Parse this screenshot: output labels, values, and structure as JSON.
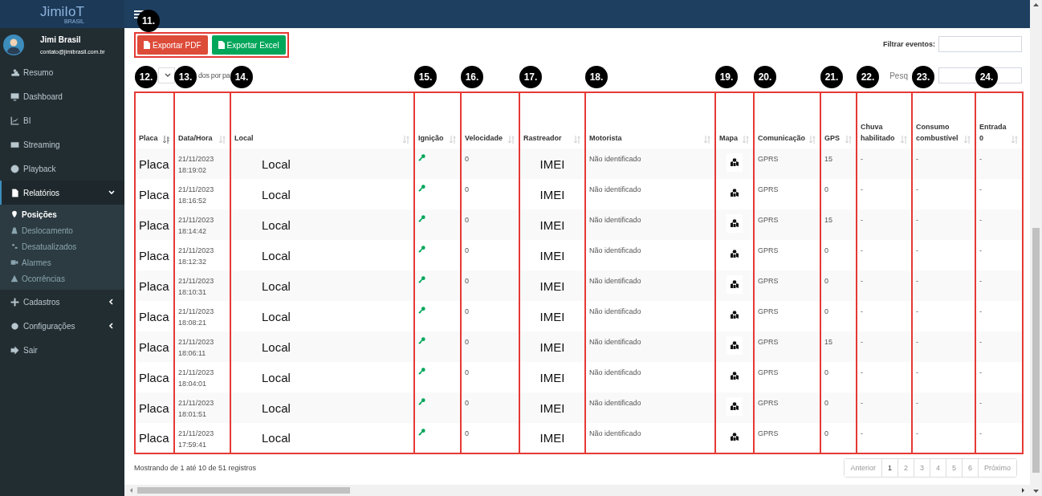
{
  "logo": {
    "name": "JimiIoT",
    "sub": "BRASIL"
  },
  "user": {
    "name": "Jimi Brasil",
    "email": "contato@jimibrasil.com.br"
  },
  "sidebar": {
    "items": [
      {
        "label": "Resumo",
        "selected": false
      },
      {
        "label": "Dashboard",
        "selected": false
      },
      {
        "label": "BI",
        "selected": false
      },
      {
        "label": "Streaming",
        "selected": false
      },
      {
        "label": "Playback",
        "selected": false
      },
      {
        "label": "Relatórios",
        "selected": true,
        "expanded": true,
        "children": [
          {
            "label": "Posições",
            "selected": true
          },
          {
            "label": "Deslocamento",
            "selected": false
          },
          {
            "label": "Desatualizados",
            "selected": false
          },
          {
            "label": "Alarmes",
            "selected": false
          },
          {
            "label": "Ocorrências",
            "selected": false
          }
        ]
      },
      {
        "label": "Cadastros",
        "selected": false,
        "expanded": false
      },
      {
        "label": "Configurações",
        "selected": false,
        "expanded": false
      },
      {
        "label": "Sair",
        "selected": false
      }
    ]
  },
  "export_buttons": [
    {
      "label": "Exportar PDF",
      "kind": "pdf"
    },
    {
      "label": "Exportar Excel",
      "kind": "excel"
    }
  ],
  "filter": {
    "label": "Filtrar eventos:"
  },
  "page_length_label": "dos por pa",
  "search_label": "Pesq",
  "annotations": {
    "export": "11.",
    "columns": [
      "12.",
      "13.",
      "14.",
      "15.",
      "16.",
      "17.",
      "18.",
      "19.",
      "20.",
      "21.",
      "22.",
      "23.",
      "24."
    ]
  },
  "table": {
    "columns": [
      {
        "label": "Placa",
        "sorted": true
      },
      {
        "label": "Data/Hora",
        "sorted": false
      },
      {
        "label": "Local",
        "sorted": false
      },
      {
        "label": "Ignição",
        "sorted": false
      },
      {
        "label": "Velocidade",
        "sorted": false
      },
      {
        "label": "Rastreador",
        "sorted": false
      },
      {
        "label": "Motorista",
        "sorted": false
      },
      {
        "label": "Mapa",
        "sorted": false
      },
      {
        "label": "Comunicação",
        "sorted": false
      },
      {
        "label": "GPS",
        "sorted": false
      },
      {
        "label": "Chuva habilitado",
        "sorted": false
      },
      {
        "label": "Consumo combustível",
        "sorted": false
      },
      {
        "label": "Entrada 0",
        "sorted": false
      }
    ],
    "rows": [
      {
        "placa": "Placa",
        "date": "21/11/2023",
        "time": "18:19:02",
        "local": "Local",
        "ignition": true,
        "speed": "0",
        "tracker": "IMEI",
        "driver": "Não identificado",
        "comm": "GPRS",
        "gps": "15",
        "rain": "-",
        "fuel": "-",
        "input0": "-"
      },
      {
        "placa": "Placa",
        "date": "21/11/2023",
        "time": "18:16:52",
        "local": "Local",
        "ignition": true,
        "speed": "0",
        "tracker": "IMEI",
        "driver": "Não identificado",
        "comm": "GPRS",
        "gps": "0",
        "rain": "-",
        "fuel": "-",
        "input0": "-"
      },
      {
        "placa": "Placa",
        "date": "21/11/2023",
        "time": "18:14:42",
        "local": "Local",
        "ignition": true,
        "speed": "0",
        "tracker": "IMEI",
        "driver": "Não identificado",
        "comm": "GPRS",
        "gps": "15",
        "rain": "-",
        "fuel": "-",
        "input0": "-"
      },
      {
        "placa": "Placa",
        "date": "21/11/2023",
        "time": "18:12:32",
        "local": "Local",
        "ignition": true,
        "speed": "0",
        "tracker": "IMEI",
        "driver": "Não identificado",
        "comm": "GPRS",
        "gps": "0",
        "rain": "-",
        "fuel": "-",
        "input0": "-"
      },
      {
        "placa": "Placa",
        "date": "21/11/2023",
        "time": "18:10:31",
        "local": "Local",
        "ignition": true,
        "speed": "0",
        "tracker": "IMEI",
        "driver": "Não identificado",
        "comm": "GPRS",
        "gps": "0",
        "rain": "-",
        "fuel": "-",
        "input0": "-"
      },
      {
        "placa": "Placa",
        "date": "21/11/2023",
        "time": "18:08:21",
        "local": "Local",
        "ignition": true,
        "speed": "0",
        "tracker": "IMEI",
        "driver": "Não identificado",
        "comm": "GPRS",
        "gps": "0",
        "rain": "-",
        "fuel": "-",
        "input0": "-"
      },
      {
        "placa": "Placa",
        "date": "21/11/2023",
        "time": "18:06:11",
        "local": "Local",
        "ignition": true,
        "speed": "0",
        "tracker": "IMEI",
        "driver": "Não identificado",
        "comm": "GPRS",
        "gps": "15",
        "rain": "-",
        "fuel": "-",
        "input0": "-"
      },
      {
        "placa": "Placa",
        "date": "21/11/2023",
        "time": "18:04:01",
        "local": "Local",
        "ignition": true,
        "speed": "0",
        "tracker": "IMEI",
        "driver": "Não identificado",
        "comm": "GPRS",
        "gps": "0",
        "rain": "-",
        "fuel": "-",
        "input0": "-"
      },
      {
        "placa": "Placa",
        "date": "21/11/2023",
        "time": "18:01:51",
        "local": "Local",
        "ignition": true,
        "speed": "0",
        "tracker": "IMEI",
        "driver": "Não identificado",
        "comm": "GPRS",
        "gps": "0",
        "rain": "-",
        "fuel": "-",
        "input0": "-"
      },
      {
        "placa": "Placa",
        "date": "21/11/2023",
        "time": "17:59:41",
        "local": "Local",
        "ignition": true,
        "speed": "0",
        "tracker": "IMEI",
        "driver": "Não identificado",
        "comm": "GPRS",
        "gps": "0",
        "rain": "-",
        "fuel": "-",
        "input0": "-"
      }
    ]
  },
  "info": "Mostrando de 1 até 10 de 51 registros",
  "pagination": [
    {
      "label": "Anterior",
      "selected": false
    },
    {
      "label": "1",
      "selected": true
    },
    {
      "label": "2",
      "selected": false
    },
    {
      "label": "3",
      "selected": false
    },
    {
      "label": "4",
      "selected": false
    },
    {
      "label": "5",
      "selected": false
    },
    {
      "label": "6",
      "selected": false
    },
    {
      "label": "Próximo",
      "selected": false
    }
  ]
}
